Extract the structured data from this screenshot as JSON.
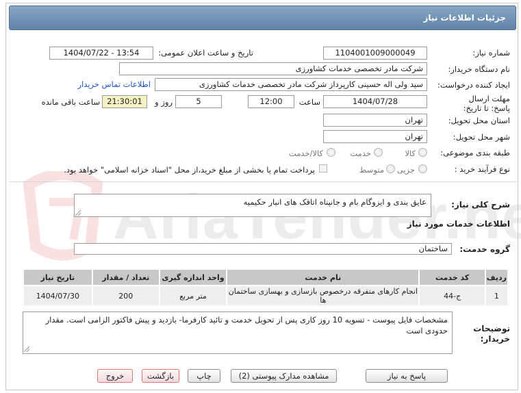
{
  "header": {
    "title": "جزئیات اطلاعات نیاز"
  },
  "fields": {
    "need_number_label": "شماره نیاز:",
    "need_number": "1104001009000049",
    "announce_label": "تاریخ و ساعت اعلان عمومی:",
    "announce_value": "1404/07/22 - 13:54",
    "buyer_org_label": "نام دستگاه خریدار:",
    "buyer_org": "شرکت مادر تخصصی خدمات کشاورزی",
    "requester_label": "ایجاد کننده درخواست:",
    "requester": "سید ولی اله  حسینی  کارپرداز شرکت مادر تخصصی خدمات کشاورزی",
    "buyer_contact_link": "اطلاعات تماس خریدار",
    "deadline_label": "مهلت ارسال پاسخ: تا تاریخ:",
    "deadline_date": "1404/07/28",
    "time_label": "ساعت",
    "deadline_time": "12:00",
    "days_value": "5",
    "days_label": "روز و",
    "remaining_time": "21:30:01",
    "remaining_label": "ساعت باقی مانده",
    "province_label": "استان محل تحویل:",
    "province": "تهران",
    "city_label": "شهر محل تحویل:",
    "city": "تهران",
    "category_label": "طبقه بندی موضوعی:",
    "category_options": [
      "کالا",
      "خدمت",
      "کالا/خدمت"
    ],
    "process_label": "نوع فرآیند خرید :",
    "process_options": [
      "جزیی",
      "متوسط"
    ],
    "payment_note": "پرداخت تمام یا بخشی از مبلغ خرید،از محل \"اسناد خزانه اسلامی\" خواهد بود."
  },
  "summary": {
    "label": "شرح کلی نیاز:",
    "text": "عایق بندی و ایزوگام بام و جانپناه اتاقک های انبار حکیمیه"
  },
  "services_title": "اطلاعات خدمات مورد نیاز",
  "service_group": {
    "label": "گروه خدمت:",
    "value": "ساختمان"
  },
  "table": {
    "headers": [
      "ردیف",
      "کد خدمت",
      "نام خدمت",
      "واحد اندازه گیری",
      "تعداد / مقدار",
      "تاریخ نیاز"
    ],
    "rows": [
      {
        "index": "1",
        "code": "ج-44",
        "name": "انجام کارهای متفرقه درخصوص بازسازی و بهسازی ساختمان ها",
        "unit": "متر مربع",
        "qty": "200",
        "date": "1404/07/30"
      }
    ]
  },
  "buyer_notes": {
    "label": "توضیحات خریدار:",
    "text": "مشخصات فایل پیوست - تسویه 10 روز کاری پس از تحویل خدمت و تائید کارفرما- بازدید و پیش فاکتور الزامی است. مقدار حدودی است"
  },
  "buttons": {
    "reply": "پاسخ به نیاز",
    "view_docs": "مشاهده مدارک پیوستی (2)",
    "print": "چاپ",
    "back": "بازگشت",
    "exit": "خروج"
  },
  "colors": {
    "header": "#6b8cb0",
    "link": "#1d52c9",
    "remaining_bg": "#f6f2c6"
  }
}
